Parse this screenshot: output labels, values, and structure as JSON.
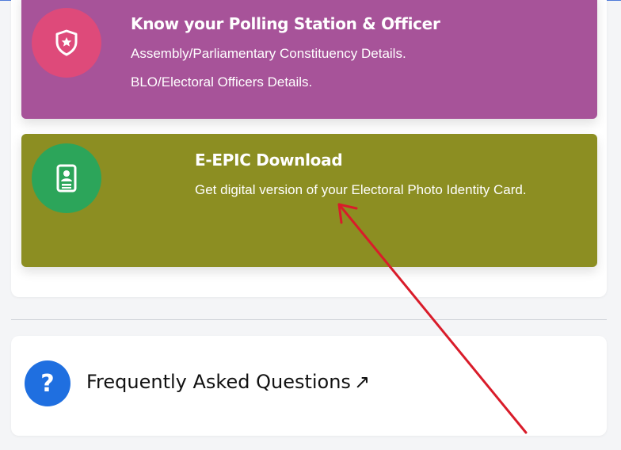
{
  "tiles": {
    "polling": {
      "title": "Know your Polling Station & Officer",
      "line1": "Assembly/Parliamentary Constituency Details.",
      "line2": "BLO/Electoral Officers Details.",
      "icon": "shield-star-icon",
      "color": "#a75399",
      "icon_bg": "#de4a7a"
    },
    "epic": {
      "title": "E-EPIC Download",
      "line1": "Get digital version of your Electoral Photo Identity Card.",
      "icon": "id-card-icon",
      "color": "#8c8e22",
      "icon_bg": "#2ca55a"
    }
  },
  "faq": {
    "title": "Frequently Asked Questions",
    "external_arrow": "↗",
    "icon_symbol": "?",
    "icon": "question-icon",
    "icon_bg": "#1f6fe0"
  },
  "annotation": {
    "arrow_color": "#d91c2a",
    "icon": "red-annotation-arrow"
  }
}
